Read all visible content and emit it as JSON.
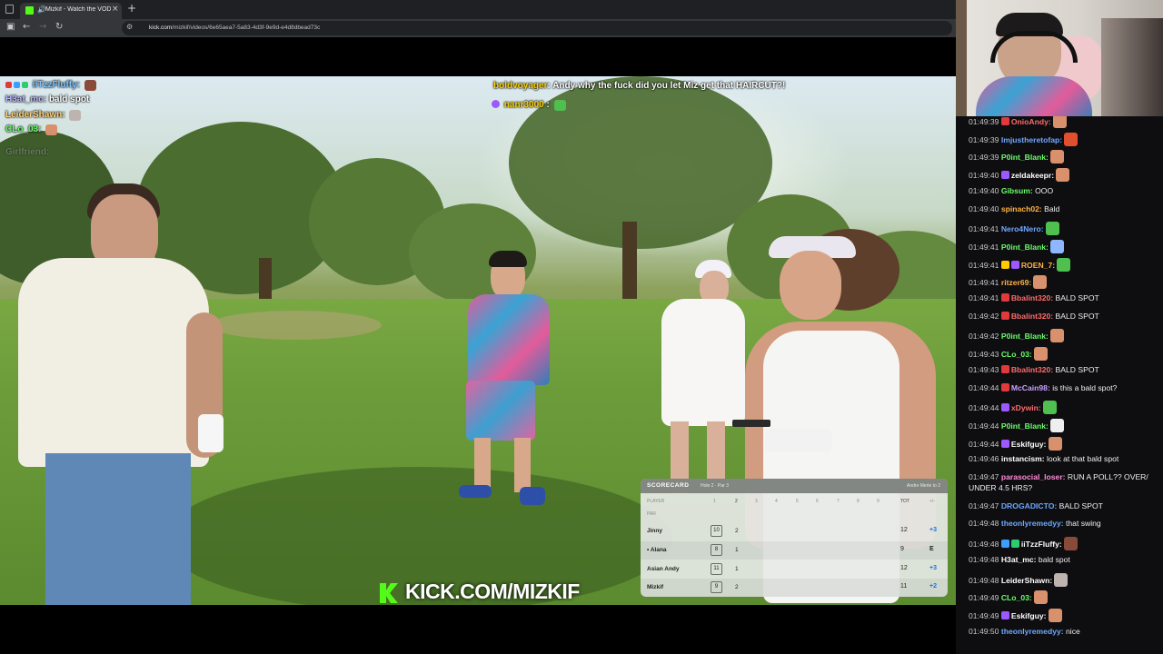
{
  "browser": {
    "tab_title": "Mizkif - Watch the VOD on",
    "tab_close": "×",
    "new_tab": "+",
    "url_host": "kick.com",
    "url_path": "/mizkif/videos/6e65aea7-5a83-4d3f-9e9d-e4d8dbead73c"
  },
  "colors": {
    "kick_green": "#53fc18",
    "chat_bg": "#0e0e10"
  },
  "overlay_chat_left": [
    {
      "user": "iiTzzFluffy:",
      "color": "#7bc4ff"
    },
    {
      "user": "H3at_mc:",
      "text": "bald spot",
      "color": "#b6b6ff"
    },
    {
      "user": "LeiderShawn:",
      "color": "#ffd47a"
    },
    {
      "user": "CLo_03:",
      "color": "#62ff62"
    },
    {
      "user": "Girlfriend:",
      "color": "#a9a9c8"
    }
  ],
  "overlay_chat_top": [
    {
      "user": "boldvoyager",
      "text": ": Andy why the fuck did you let Miz get that HAIRCUT?!",
      "color": "#ffd400"
    },
    {
      "user": "nanr3000",
      "text": " :",
      "color": "#ffd400"
    }
  ],
  "banner": {
    "text": "KICK.COM/MIZKIF"
  },
  "scorecard": {
    "title": "SCORECARD",
    "hole": "Hole 2 · Par 3",
    "note": "Andre Merle to 2",
    "player_label": "PLAYER",
    "par_label": "PAR",
    "tot_label": "TOT",
    "pm_label": "+/-",
    "holes": [
      "1",
      "2",
      "3",
      "4",
      "5",
      "6",
      "7",
      "8",
      "9"
    ],
    "rows": [
      {
        "name": "Jinny",
        "h1": "10",
        "h2": "2",
        "tot": "12",
        "pm": "+3",
        "pm_color": "#1a73e8"
      },
      {
        "name": "• Alana",
        "h1": "8",
        "h2": "1",
        "tot": "9",
        "pm": "E",
        "pm_color": "#222222"
      },
      {
        "name": "Asian Andy",
        "h1": "11",
        "h2": "1",
        "tot": "12",
        "pm": "+3",
        "pm_color": "#1a73e8"
      },
      {
        "name": "Mizkif",
        "h1": "9",
        "h2": "2",
        "tot": "11",
        "pm": "+2",
        "pm_color": "#1a73e8"
      }
    ]
  },
  "chat": [
    {
      "time": "01:49:39",
      "user": "OnioAndy:",
      "text": "",
      "color": "#ff6b6b",
      "badges": [
        "#e23a3a"
      ],
      "emote": "#d9906c"
    },
    {
      "time": "01:49:39",
      "user": "Imjustheretofap:",
      "text": "",
      "color": "#6fa8ff",
      "badges": [],
      "emote": "#e0502f"
    },
    {
      "time": "01:49:39",
      "user": "P0int_Blank:",
      "text": "",
      "color": "#6bff6b",
      "badges": [],
      "emote": "#d9906c"
    },
    {
      "time": "01:49:40",
      "user": "zeldakeepr:",
      "text": "",
      "color": "#ffffff",
      "badges": [
        "#9b59ff"
      ],
      "emote": "#d9906c"
    },
    {
      "time": "01:49:40",
      "user": "Gibsum:",
      "text": "OOO",
      "color": "#6bff6b",
      "badges": [],
      "emote": ""
    },
    {
      "time": "01:49:40",
      "user": "spinach02:",
      "text": "Bald",
      "color": "#ffb347",
      "badges": [],
      "emote": ""
    },
    {
      "time": "01:49:41",
      "user": "Nero4Nero:",
      "text": "",
      "color": "#6fa8ff",
      "badges": [],
      "emote": "#4fbf4f"
    },
    {
      "time": "01:49:41",
      "user": "P0int_Blank:",
      "text": "",
      "color": "#6bff6b",
      "badges": [],
      "emote": "#8fb7ff"
    },
    {
      "time": "01:49:41",
      "user": "ROEN_7:",
      "text": "",
      "color": "#ffb347",
      "badges": [
        "#ffcc00",
        "#9b59ff"
      ],
      "emote": "#4fbf4f"
    },
    {
      "time": "01:49:41",
      "user": "ritzer69:",
      "text": "",
      "color": "#ffb347",
      "badges": [],
      "emote": "#d9906c"
    },
    {
      "time": "01:49:41",
      "user": "Bbalint320:",
      "text": "BALD SPOT",
      "color": "#ff6b6b",
      "badges": [
        "#e23a3a"
      ],
      "emote": ""
    },
    {
      "time": "01:49:42",
      "user": "Bbalint320:",
      "text": "BALD SPOT",
      "color": "#ff6b6b",
      "badges": [
        "#e23a3a"
      ],
      "emote": ""
    },
    {
      "time": "01:49:42",
      "user": "P0int_Blank:",
      "text": "",
      "color": "#6bff6b",
      "badges": [],
      "emote": "#d9906c"
    },
    {
      "time": "01:49:43",
      "user": "CLo_03:",
      "text": "",
      "color": "#6bff6b",
      "badges": [],
      "emote": "#d9906c"
    },
    {
      "time": "01:49:43",
      "user": "Bbalint320:",
      "text": "BALD SPOT",
      "color": "#ff6b6b",
      "badges": [
        "#e23a3a"
      ],
      "emote": ""
    },
    {
      "time": "01:49:44",
      "user": "McCain98:",
      "text": "is this a bald spot?",
      "color": "#c9a0ff",
      "badges": [
        "#e23a3a"
      ],
      "emote": ""
    },
    {
      "time": "01:49:44",
      "user": "xDywin:",
      "text": "",
      "color": "#ff6b6b",
      "badges": [
        "#9b59ff"
      ],
      "emote": "#4fbf4f"
    },
    {
      "time": "01:49:44",
      "user": "P0int_Blank:",
      "text": "",
      "color": "#6bff6b",
      "badges": [],
      "emote": "#eeeeee"
    },
    {
      "time": "01:49:44",
      "user": "Eskifguy:",
      "text": "",
      "color": "#ffffff",
      "badges": [
        "#9b59ff"
      ],
      "emote": "#d9906c"
    },
    {
      "time": "01:49:46",
      "user": "instancism:",
      "text": "look at that bald spot",
      "color": "#ffffff",
      "badges": [],
      "emote": ""
    },
    {
      "time": "01:49:47",
      "user": "parasocial_loser:",
      "text": "RUN A POLL?? OVER/",
      "text2": "UNDER 4.5 HRS?",
      "color": "#ff8ad8",
      "badges": [],
      "emote": ""
    },
    {
      "time": "01:49:47",
      "user": "DROGADICTO:",
      "text": "BALD SPOT",
      "color": "#6fa8ff",
      "badges": [],
      "emote": ""
    },
    {
      "time": "01:49:48",
      "user": "theonlyremedyy:",
      "text": "that swing",
      "color": "#6fa8ff",
      "badges": [],
      "emote": ""
    },
    {
      "time": "01:49:48",
      "user": "iiTzzFluffy:",
      "text": "",
      "color": "#ffffff",
      "badges": [
        "#3aa0ff",
        "#2ecc71"
      ],
      "emote": "#8a4a3a"
    },
    {
      "time": "01:49:48",
      "user": "H3at_mc:",
      "text": "bald spot",
      "color": "#ffffff",
      "badges": [],
      "emote": ""
    },
    {
      "time": "01:49:48",
      "user": "LeiderShawn:",
      "text": "",
      "color": "#ffffff",
      "badges": [],
      "emote": "#bdb4b0"
    },
    {
      "time": "01:49:49",
      "user": "CLo_03:",
      "text": "",
      "color": "#6bff6b",
      "badges": [],
      "emote": "#d9906c"
    },
    {
      "time": "01:49:49",
      "user": "Eskifguy:",
      "text": "",
      "color": "#ffffff",
      "badges": [
        "#9b59ff"
      ],
      "emote": "#d9906c"
    },
    {
      "time": "01:49:50",
      "user": "theonlyremedyy:",
      "text": "nice",
      "color": "#6fa8ff",
      "badges": [],
      "emote": ""
    }
  ]
}
